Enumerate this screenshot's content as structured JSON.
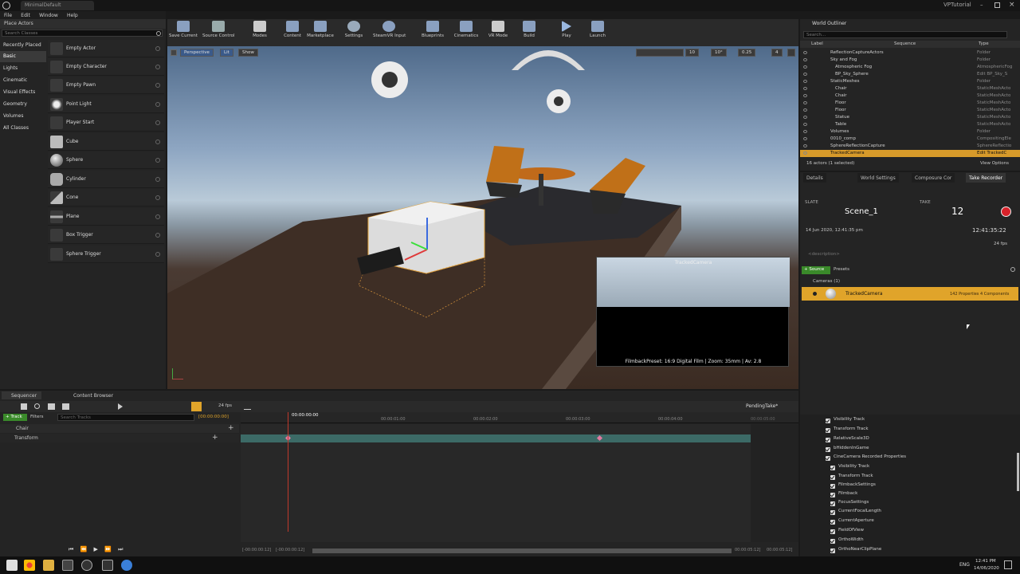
{
  "titlebar": {
    "doc_tab": "MinimalDefault",
    "project": "VPTutorial"
  },
  "menu": [
    "File",
    "Edit",
    "Window",
    "Help"
  ],
  "place_actors": {
    "tab": "Place Actors",
    "search_placeholder": "Search Classes",
    "categories": [
      "Recently Placed",
      "Basic",
      "Lights",
      "Cinematic",
      "Visual Effects",
      "Geometry",
      "Volumes",
      "All Classes"
    ],
    "selected_category": "Basic",
    "items": [
      "Empty Actor",
      "Empty Character",
      "Empty Pawn",
      "Point Light",
      "Player Start",
      "Cube",
      "Sphere",
      "Cylinder",
      "Cone",
      "Plane",
      "Box Trigger",
      "Sphere Trigger"
    ]
  },
  "toolbar": [
    "Save Current",
    "Source Control",
    "Modes",
    "Content",
    "Marketplace",
    "Settings",
    "SteamVR Input",
    "Blueprints",
    "Cinematics",
    "VR Mode",
    "Build",
    "Play",
    "Launch"
  ],
  "viewport": {
    "perspective": "Perspective",
    "lit": "Lit",
    "show": "Show",
    "grid": "10",
    "angle": "10°",
    "scale": "0.25",
    "cam_speed": "4",
    "pip_title": "TrackedCamera",
    "pip_caption": "FilmbackPreset: 16:9 Digital Film | Zoom: 35mm | Av: 2.8"
  },
  "outliner": {
    "tab": "World Outliner",
    "search_placeholder": "Search...",
    "col_label": "Label",
    "col_sequence": "Sequence",
    "col_type": "Type",
    "rows": [
      {
        "name": "ReflectionCaptureActors",
        "type": "Folder"
      },
      {
        "name": "Sky and Fog",
        "type": "Folder"
      },
      {
        "name": "Atmospheric Fog",
        "type": "AtmosphericFog"
      },
      {
        "name": "BP_Sky_Sphere",
        "type": "Edit BP_Sky_S"
      },
      {
        "name": "StaticMeshes",
        "type": "Folder"
      },
      {
        "name": "Chair",
        "type": "StaticMeshActo"
      },
      {
        "name": "Chair",
        "type": "StaticMeshActo"
      },
      {
        "name": "Floor",
        "type": "StaticMeshActo"
      },
      {
        "name": "Floor",
        "type": "StaticMeshActo"
      },
      {
        "name": "Statue",
        "type": "StaticMeshActo"
      },
      {
        "name": "Table",
        "type": "StaticMeshActo"
      },
      {
        "name": "Volumes",
        "type": "Folder"
      },
      {
        "name": "0010_comp",
        "type": "CompositingEle"
      },
      {
        "name": "SphereReflectionCapture",
        "type": "SphereReflectio"
      },
      {
        "name": "TrackedCamera",
        "type": "Edit TrackedC"
      }
    ],
    "status": "16 actors (1 selected)",
    "view_options": "View Options"
  },
  "details": {
    "tabs": [
      "Details",
      "World Settings",
      "Composure Cor",
      "Take Recorder"
    ],
    "slate_label": "SLATE",
    "slate": "Scene_1",
    "take_label": "TAKE",
    "take": "12",
    "date": "14 Jun 2020, 12:41:35 pm",
    "timecode": "12:41:35:22",
    "fps": "24 fps",
    "description": "<description>",
    "source_button": "+ Source",
    "presets": "Presets",
    "cameras_group": "Cameras (1)",
    "camera_name": "TrackedCamera",
    "camera_info": "142 Properties 4 Components"
  },
  "properties": [
    {
      "label": "Visibility Track",
      "indent": 0
    },
    {
      "label": "Transform Track",
      "indent": 0
    },
    {
      "label": "RelativeScale3D",
      "indent": 0
    },
    {
      "label": "bHiddenInGame",
      "indent": 0
    },
    {
      "label": "CineCamera  Recorded Properties",
      "indent": 0
    },
    {
      "label": "Visibility Track",
      "indent": 1
    },
    {
      "label": "Transform Track",
      "indent": 1
    },
    {
      "label": "FilmbackSettings",
      "indent": 1
    },
    {
      "label": "Filmback",
      "indent": 1
    },
    {
      "label": "FocusSettings",
      "indent": 1
    },
    {
      "label": "CurrentFocalLength",
      "indent": 1
    },
    {
      "label": "CurrentAperture",
      "indent": 1
    },
    {
      "label": "FieldOfView",
      "indent": 1
    },
    {
      "label": "OrthoWidth",
      "indent": 1
    },
    {
      "label": "OrthoNearClipPlane",
      "indent": 1
    }
  ],
  "sequencer": {
    "tabs": [
      "Sequencer",
      "Content Browser"
    ],
    "fps": "24 fps",
    "take_name": "PendingTake*",
    "track_button": "+ Track",
    "filters": "Filters",
    "search_placeholder": "Search Tracks",
    "current_time": "[00:00:00:00]",
    "playhead": "00:00:00:00",
    "ruler": [
      "00:00:01:00",
      "00:00:02:00",
      "00:00:03:00",
      "00:00:04:00",
      "00:00:05:00"
    ],
    "tracks": [
      {
        "name": "Chair"
      },
      {
        "name": "Transform"
      }
    ],
    "range_start": "[-00:00:00:12]",
    "range_start2": "[-00:00:00:12]",
    "range_end": "00:00:05:12]",
    "range_end2": "00:00:05:12]"
  },
  "taskbar": {
    "time": "12:41 PM",
    "date": "14/06/2020",
    "lang": "ENG"
  }
}
